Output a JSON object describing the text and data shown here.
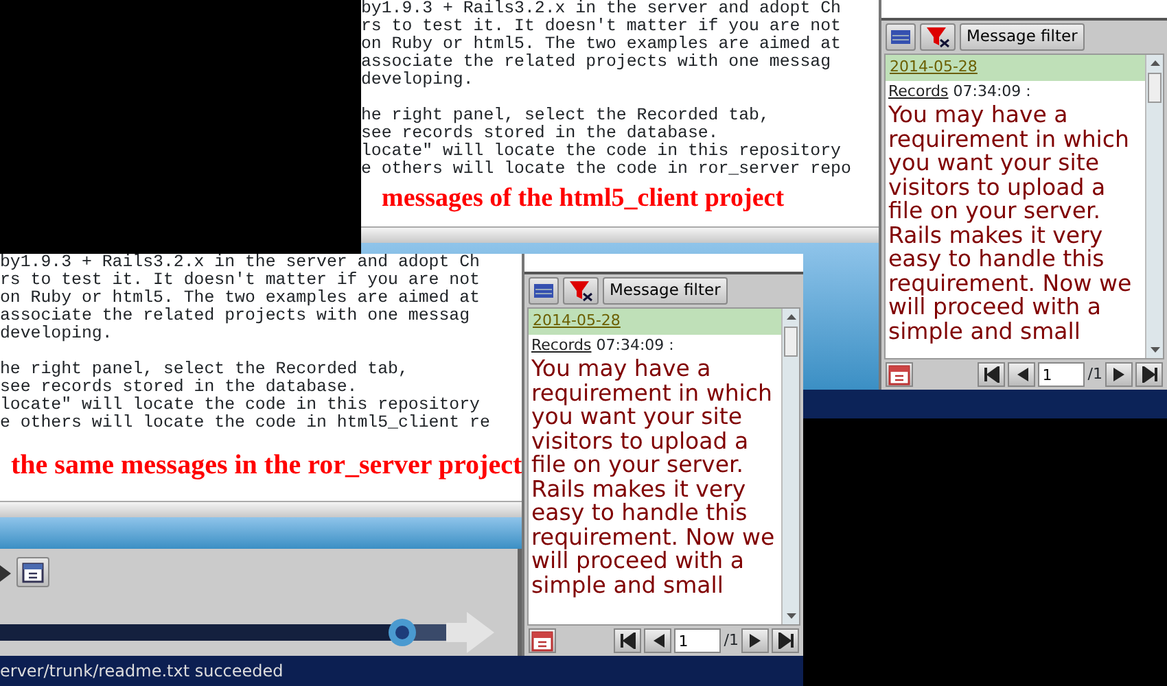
{
  "back_window": {
    "document_lines": [
      "by1.9.3 + Rails3.2.x in the server and adopt Ch",
      "rs to test it. It doesn't matter if you are not",
      "on Ruby or html5. The two examples are aimed at",
      "associate the related projects with one messag",
      "developing.",
      "he right panel, select the Recorded tab,",
      "see records stored in the database.",
      "locate\" will locate the code in this repository",
      "e others will locate the code in ror_server repo"
    ],
    "annotation": "messages of the html5_client project",
    "message_panel": {
      "filter_button": "Message filter",
      "date": "2014-05-28",
      "records_link": "Records",
      "time": "07:34:09 :",
      "message": "You may have a requirement in which you want your site visitors to upload a file on your server. Rails makes it very easy to handle this requirement. Now we will proceed with a simple and small",
      "page_input": "1",
      "page_total": "/1"
    }
  },
  "front_window": {
    "document_lines": [
      "by1.9.3 + Rails3.2.x in the server and adopt Ch",
      "rs to test it. It doesn't matter if you are not",
      "on Ruby or html5. The two examples are aimed at",
      "associate the related projects with one messag",
      "developing.",
      "he right panel, select the Recorded tab,",
      "see records stored in the database.",
      "locate\" will locate the code in this repository",
      "e others will locate the code in html5_client re"
    ],
    "annotation": "the same messages in the ror_server project",
    "message_panel": {
      "filter_button": "Message filter",
      "date": "2014-05-28",
      "records_link": "Records",
      "time": "07:34:09 :",
      "message": "You may have a requirement in which you want your site visitors to upload a file on your server. Rails makes it very easy to handle this requirement. Now we will proceed with a simple and small",
      "page_input": "1",
      "page_total": "/1"
    },
    "timeline": {
      "level": 0.9
    },
    "status_bar": "erver/trunk/readme.txt succeeded"
  }
}
